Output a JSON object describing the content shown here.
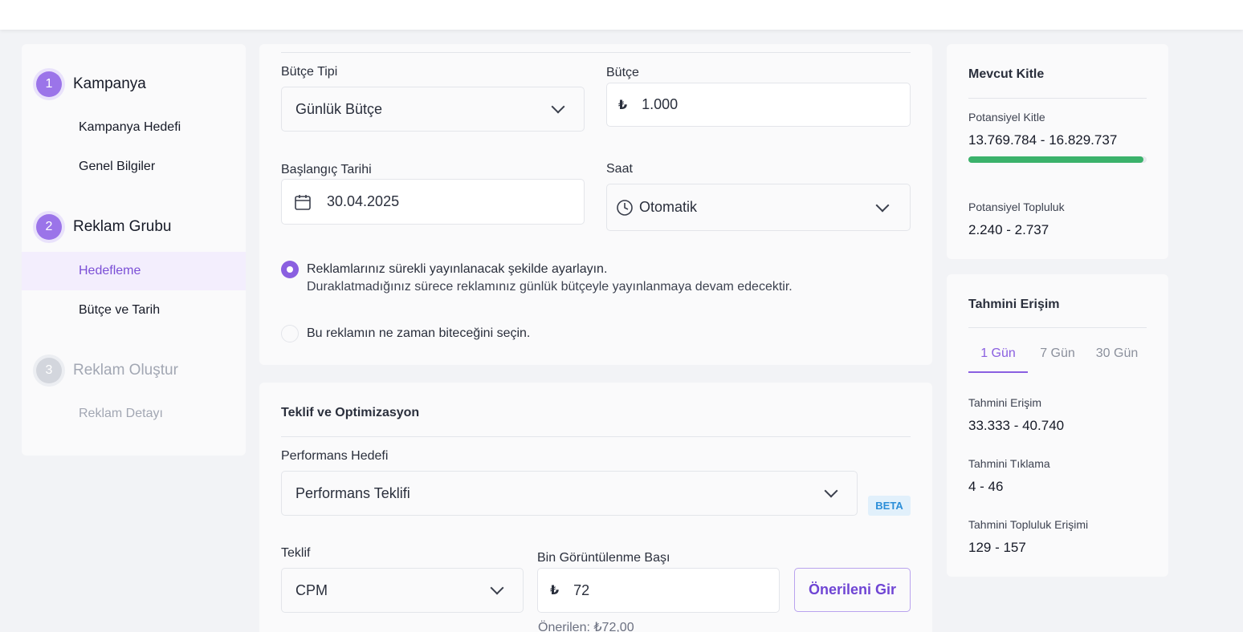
{
  "sidebar": {
    "steps": [
      {
        "number": "1",
        "title": "Kampanya",
        "items": [
          "Kampanya Hedefi",
          "Genel Bilgiler"
        ]
      },
      {
        "number": "2",
        "title": "Reklam Grubu",
        "items": [
          "Hedefleme",
          "Bütçe ve Tarih"
        ]
      },
      {
        "number": "3",
        "title": "Reklam Oluştur",
        "items": [
          "Reklam Detayı"
        ]
      }
    ]
  },
  "budget": {
    "type_label": "Bütçe Tipi",
    "type_value": "Günlük Bütçe",
    "amount_label": "Bütçe",
    "currency": "₺",
    "amount_value": "1.000",
    "start_label": "Başlangıç Tarihi",
    "start_value": "30.04.2025",
    "time_label": "Saat",
    "time_value": "Otomatik",
    "option1_line1": "Reklamlarınız sürekli yayınlanacak şekilde ayarlayın.",
    "option1_line2": "Duraklatmadığınız sürece reklamınız günlük bütçeyle yayınlanmaya devam edecektir.",
    "option2": "Bu reklamın ne zaman biteceğini seçin."
  },
  "bidding": {
    "title": "Teklif ve Optimizasyon",
    "goal_label": "Performans Hedefi",
    "goal_value": "Performans Teklifi",
    "beta": "BETA",
    "bid_label": "Teklif",
    "bid_value": "CPM",
    "cpm_label": "Bin Görüntülenme Başı",
    "currency": "₺",
    "cpm_value": "72",
    "suggest_button": "Önerileni Gir",
    "suggested_text": "Önerilen: ₺72,00"
  },
  "audience": {
    "title": "Mevcut Kitle",
    "potential_label": "Potansiyel Kitle",
    "potential_value": "13.769.784 - 16.829.737",
    "potential_fill": 0.98,
    "community_label": "Potansiyel Topluluk",
    "community_value": "2.240 - 2.737"
  },
  "reach": {
    "title": "Tahmini Erişim",
    "tabs": [
      "1 Gün",
      "7 Gün",
      "30 Gün"
    ],
    "active_tab": "1 Gün",
    "reach_label": "Tahmini Erişim",
    "reach_value": "33.333 - 40.740",
    "clicks_label": "Tahmini Tıklama",
    "clicks_value": "4 - 46",
    "community_label": "Tahmini Topluluk Erişimi",
    "community_value": "129 - 157"
  },
  "colors": {
    "accent": "#8a5fe0",
    "progress": "#3bb26b",
    "beta": "#2b8ed8"
  }
}
